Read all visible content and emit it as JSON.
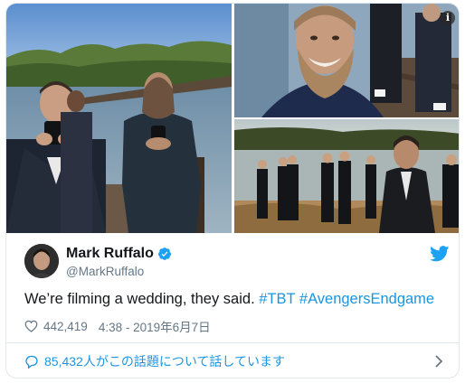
{
  "tweet": {
    "author": {
      "display_name": "Mark Ruffalo",
      "handle": "@MarkRuffalo",
      "verified": true
    },
    "text_plain": "We’re filming a wedding, they said.",
    "hashtags": [
      "#TBT",
      "#AvengersEndgame"
    ],
    "likes": "442,419",
    "timestamp": "4:38 - 2019年6月7日",
    "conversation_label": "85,432人がこの話題について話しています"
  },
  "media": {
    "info_icon_label": "i",
    "photos": [
      {
        "scene": "two men holding phones by a lake"
      },
      {
        "scene": "bearded man smiling on a dock"
      },
      {
        "scene": "group of people in suits by a lake"
      }
    ]
  },
  "colors": {
    "link": "#1b95e0",
    "secondary_text": "#657786",
    "verified": "#1da1f2",
    "border": "#e1e8ed"
  },
  "icons": {
    "like": "heart-outline-icon",
    "brand": "twitter-bird-icon",
    "conversation": "speech-bubble-icon",
    "more": "chevron-right-icon",
    "badge": "verified-badge-icon"
  }
}
